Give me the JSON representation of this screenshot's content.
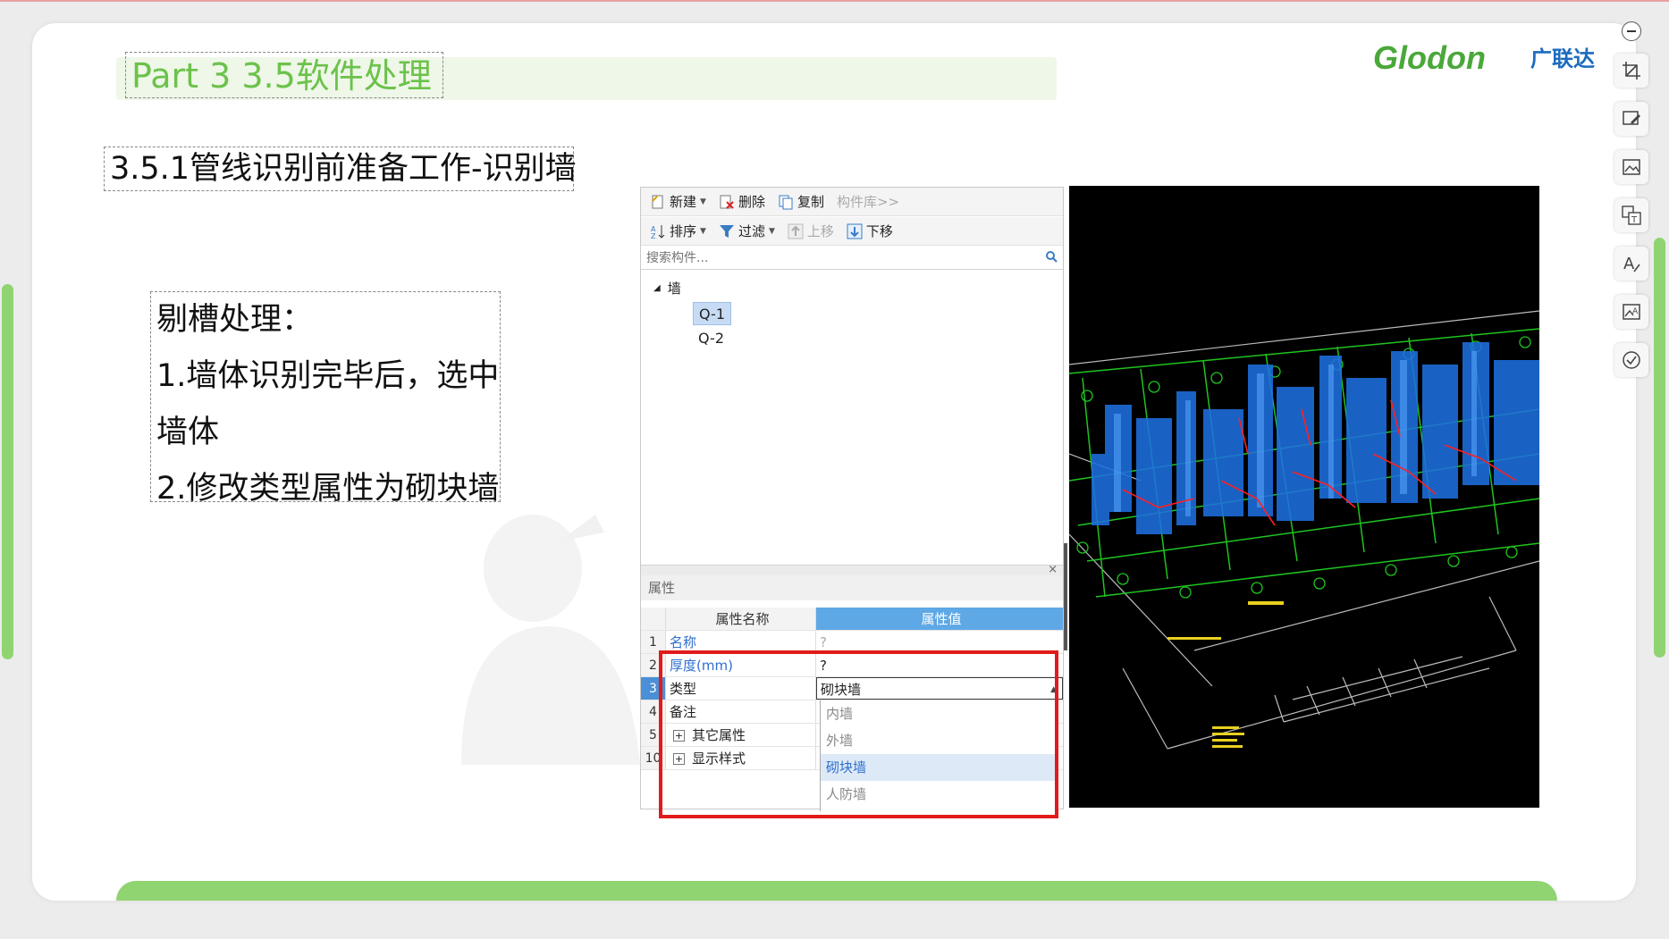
{
  "slide": {
    "title": "Part 3  3.5软件处理",
    "subtitle": "3.5.1管线识别前准备工作-识别墙",
    "content_lines": [
      "剔槽处理：",
      "1.墙体识别完毕后，选中",
      "墙体",
      "2.修改类型属性为砌块墙"
    ],
    "logo_text": "Glodon",
    "logo_cn": "广联达"
  },
  "software": {
    "toolbar1": {
      "new_label": "新建",
      "delete_label": "删除",
      "copy_label": "复制",
      "library_label": "构件库>>"
    },
    "toolbar2": {
      "sort_label": "排序",
      "filter_label": "过滤",
      "up_label": "上移",
      "down_label": "下移"
    },
    "search": {
      "placeholder": "搜索构件..."
    },
    "tree": {
      "root": "墙",
      "items": [
        "Q-1",
        "Q-2"
      ],
      "selected": "Q-1"
    },
    "properties": {
      "panel_title": "属性",
      "header_name": "属性名称",
      "header_value": "属性值",
      "rows": [
        {
          "num": "1",
          "name": "名称",
          "value": "?"
        },
        {
          "num": "2",
          "name": "厚度(mm)",
          "value": "?"
        },
        {
          "num": "3",
          "name": "类型",
          "value": "砌块墙"
        },
        {
          "num": "4",
          "name": "备注",
          "value": ""
        },
        {
          "num": "5",
          "name": "其它属性",
          "value": ""
        },
        {
          "num": "10",
          "name": "显示样式",
          "value": ""
        }
      ],
      "dropdown_options": [
        "内墙",
        "外墙",
        "砌块墙",
        "人防墙"
      ],
      "dropdown_highlight": "砌块墙"
    }
  },
  "colors": {
    "accent_green": "#8fd471",
    "title_green": "#6cc24a",
    "highlight_red": "#e11b1b",
    "header_blue": "#5ea8e6",
    "logo_green": "#4aa83a",
    "logo_blue": "#1c6bbf"
  }
}
